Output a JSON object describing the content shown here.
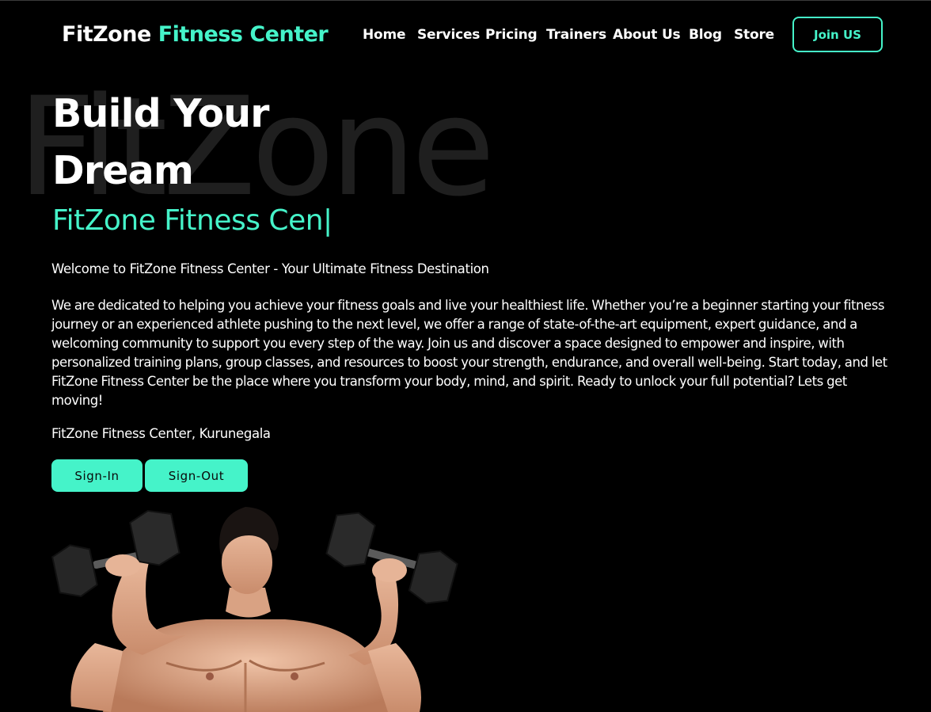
{
  "header": {
    "brand_part1": "FitZone",
    "brand_part2": "Fitness Center",
    "nav": [
      "Home",
      "Services",
      "Pricing",
      "Trainers",
      "About Us",
      "Blog",
      "Store"
    ],
    "join_label": "Join US"
  },
  "hero": {
    "watermark": "FitZone",
    "title_line1": "Build Your",
    "title_line2": "Dream",
    "typed_text": "FitZone Fitness Cen",
    "typed_cursor": "|",
    "welcome": "Welcome to FitZone Fitness Center - Your Ultimate Fitness Destination",
    "description": "We are dedicated to helping you achieve your fitness goals and live your healthiest life. Whether you’re a beginner starting your fitness journey or an experienced athlete pushing to the next level, we offer a range of state-of-the-art equipment, expert guidance, and a welcoming community to support you every step of the way. Join us and discover a space designed to empower and inspire, with personalized training plans, group classes, and resources to boost your strength, endurance, and overall well-being. Start today, and let FitZone Fitness Center be the place where you transform your body, mind, and spirit. Ready to unlock your full potential? Lets get moving!",
    "location": "FitZone Fitness Center, Kurunegala",
    "signin_label": "Sign-In",
    "signout_label": "Sign-Out"
  },
  "colors": {
    "accent": "#45f3c9",
    "background": "#000000",
    "text": "#ffffff",
    "watermark": "#1f1f1f"
  }
}
